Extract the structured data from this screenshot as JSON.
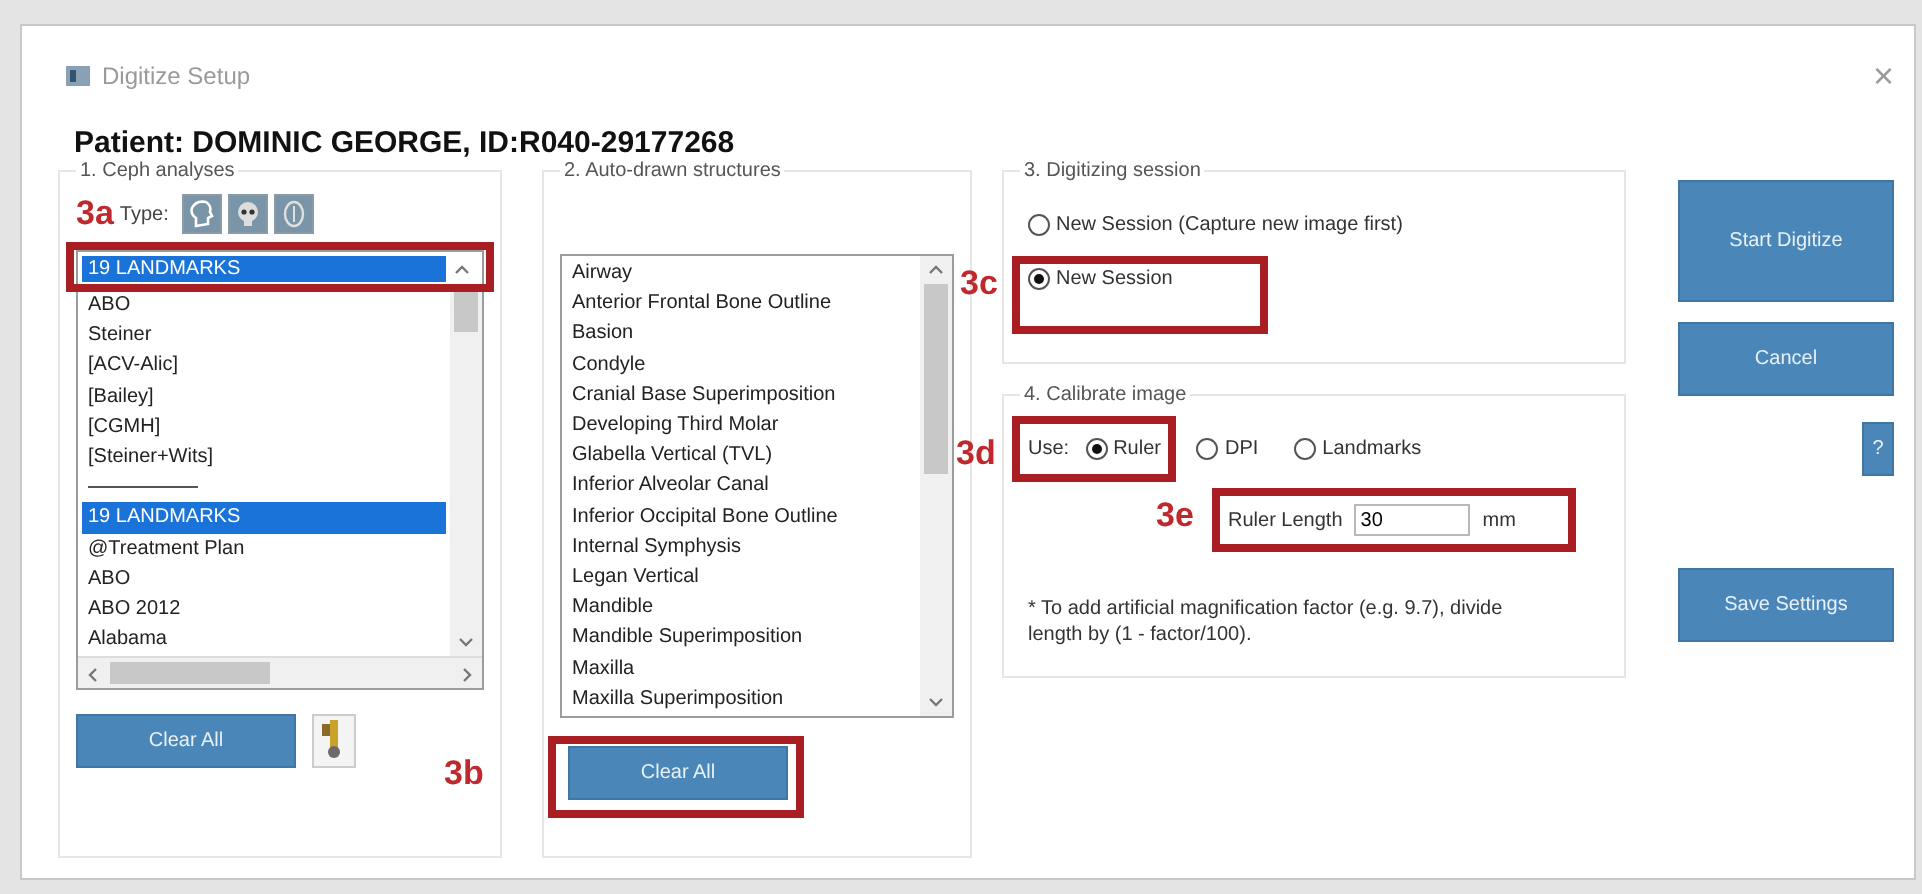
{
  "window": {
    "title": "Digitize Setup",
    "close": "×"
  },
  "patient": "Patient: DOMINIC GEORGE, ID:R040-29177268",
  "ceph": {
    "legend": "1. Ceph analyses",
    "type_label": "Type:",
    "type_buttons": [
      {
        "kind": "profile"
      },
      {
        "kind": "skull"
      },
      {
        "kind": "face"
      }
    ],
    "combo": {
      "value": "19 LANDMARKS",
      "annotation": "3a"
    },
    "items": [
      {
        "kind": "item",
        "text": "ABO",
        "selected": false
      },
      {
        "kind": "item",
        "text": "Steiner",
        "selected": false
      },
      {
        "kind": "item",
        "text": "[ACV-Alic]",
        "selected": false
      },
      {
        "kind": "item",
        "text": "[Bailey]",
        "selected": false
      },
      {
        "kind": "item",
        "text": "[CGMH]",
        "selected": false
      },
      {
        "kind": "item",
        "text": "[Steiner+Wits]",
        "selected": false
      },
      {
        "kind": "separator"
      },
      {
        "kind": "item",
        "text": "19 LANDMARKS",
        "selected": true
      },
      {
        "kind": "item",
        "text": "@Treatment Plan",
        "selected": false
      },
      {
        "kind": "item",
        "text": "ABO",
        "selected": false
      },
      {
        "kind": "item",
        "text": "ABO 2012",
        "selected": false
      },
      {
        "kind": "item",
        "text": "Alabama",
        "selected": false
      }
    ],
    "clear_button": "Clear All"
  },
  "structures": {
    "legend": "2. Auto-drawn structures",
    "items": [
      "Airway",
      "Anterior Frontal Bone Outline",
      "Basion",
      "Condyle",
      "Cranial Base Superimposition",
      "Developing Third Molar",
      "Glabella Vertical (TVL)",
      "Inferior Alveolar Canal",
      "Inferior Occipital Bone Outline",
      "Internal Symphysis",
      "Legan Vertical",
      "Mandible",
      "Mandible Superimposition",
      "Maxilla",
      "Maxilla Superimposition"
    ],
    "clear_button": {
      "label": "Clear All",
      "annotation": "3b"
    }
  },
  "session": {
    "legend": "3. Digitizing session",
    "options": [
      {
        "label": "New Session (Capture new image first)",
        "selected": false
      },
      {
        "label": "New Session",
        "selected": true,
        "annotation": "3c"
      }
    ]
  },
  "calibrate": {
    "legend": "4. Calibrate image",
    "use_label": "Use:",
    "use_annotation": "3d",
    "options": [
      {
        "label": "Ruler",
        "selected": true
      },
      {
        "label": "DPI",
        "selected": false
      },
      {
        "label": "Landmarks",
        "selected": false
      }
    ],
    "ruler": {
      "label": "Ruler Length",
      "value": "30",
      "unit": "mm",
      "annotation": "3e"
    },
    "note": "* To add artificial magnification factor (e.g. 9.7), divide length by (1 - factor/100)."
  },
  "actions": [
    {
      "label": "Start Digitize",
      "kind": "large"
    },
    {
      "label": "Cancel",
      "kind": "medium"
    },
    {
      "label": "?",
      "kind": "help"
    },
    {
      "label": "Save Settings",
      "kind": "medium"
    }
  ]
}
